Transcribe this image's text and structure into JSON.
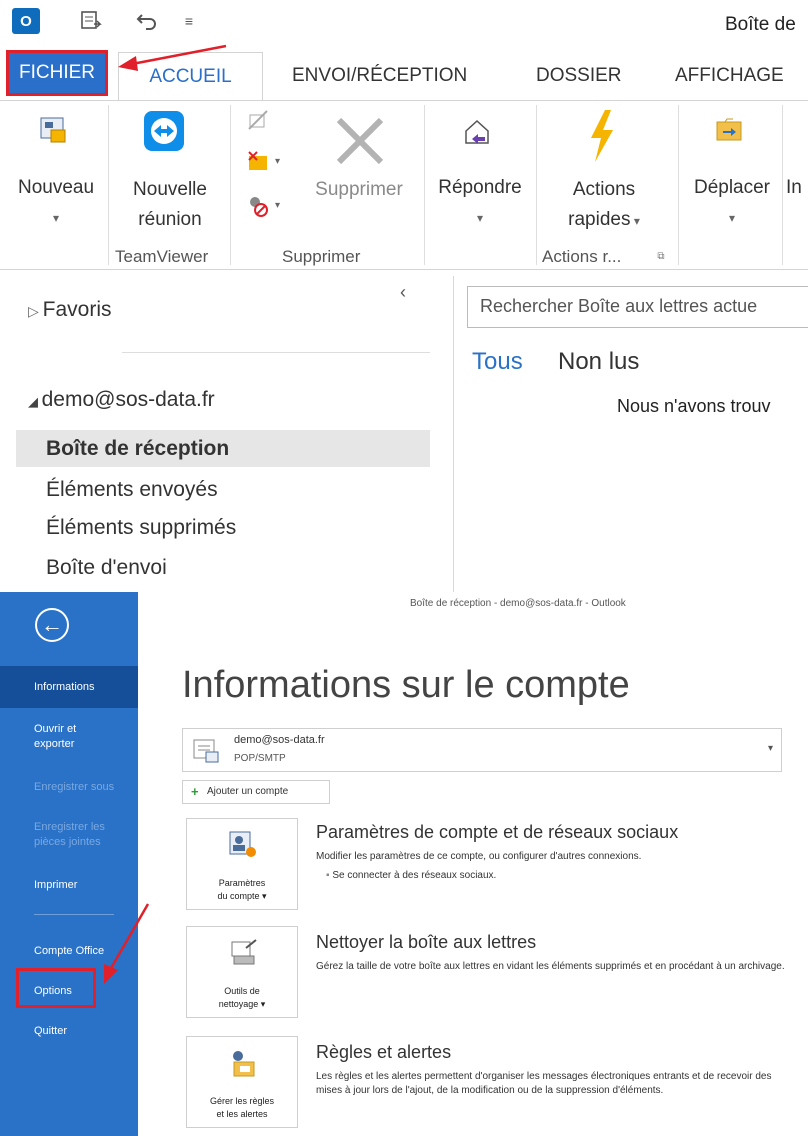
{
  "top": {
    "qat": {
      "app_icon_text": "O",
      "window_title": "Boîte de"
    },
    "tabs": [
      "FICHIER",
      "ACCUEIL",
      "ENVOI/RÉCEPTION",
      "DOSSIER",
      "AFFICHAGE"
    ],
    "ribbon": {
      "nouveau": "Nouveau",
      "nouvelle_reunion_1": "Nouvelle",
      "nouvelle_reunion_2": "réunion",
      "supprimer": "Supprimer",
      "repondre": "Répondre",
      "actions_1": "Actions",
      "actions_2": "rapides",
      "deplacer": "Déplacer",
      "partial": "In",
      "group_teamviewer": "TeamViewer",
      "group_supprimer": "Supprimer",
      "group_actions": "Actions r..."
    },
    "folder_pane": {
      "favorites": "Favoris",
      "account": "demo@sos-data.fr",
      "folders": [
        "Boîte de réception",
        "Éléments envoyés",
        "Éléments supprimés",
        "Boîte d'envoi"
      ]
    },
    "mail_list": {
      "search_placeholder": "Rechercher Boîte aux lettres actue",
      "filter_all": "Tous",
      "filter_unread": "Non lus",
      "empty_text": "Nous n'avons trouv"
    }
  },
  "backstage": {
    "window_title": "Boîte de réception - demo@sos-data.fr - Outlook",
    "nav": {
      "informations": "Informations",
      "ouvrir_1": "Ouvrir et",
      "ouvrir_2": "exporter",
      "enregistrer_sous": "Enregistrer sous",
      "enreg_pj_1": "Enregistrer les",
      "enreg_pj_2": "pièces jointes",
      "imprimer": "Imprimer",
      "compte_office": "Compte Office",
      "options": "Options",
      "quitter": "Quitter"
    },
    "heading": "Informations sur le compte",
    "account": {
      "email": "demo@sos-data.fr",
      "type": "POP/SMTP"
    },
    "add_account": "Ajouter un compte",
    "sections": [
      {
        "title": "Paramètres de compte et de réseaux sociaux",
        "desc": "Modifier les paramètres de ce compte, ou configurer d'autres connexions.",
        "sub": "Se connecter à des réseaux sociaux.",
        "btn_1": "Paramètres",
        "btn_2": "du compte ▾"
      },
      {
        "title": "Nettoyer la boîte aux lettres",
        "desc": "Gérez la taille de votre boîte aux lettres en vidant les éléments supprimés et en procédant à un archivage.",
        "btn_1": "Outils de",
        "btn_2": "nettoyage ▾"
      },
      {
        "title": "Règles et alertes",
        "desc": "Les règles et les alertes permettent d'organiser les messages électroniques entrants et de recevoir des mises à jour lors de l'ajout, de la modification ou de la suppression d'éléments.",
        "btn_1": "Gérer les règles",
        "btn_2": "et les alertes"
      }
    ]
  },
  "colors": {
    "accent": "#2a72c7",
    "highlight": "#e0202a"
  }
}
